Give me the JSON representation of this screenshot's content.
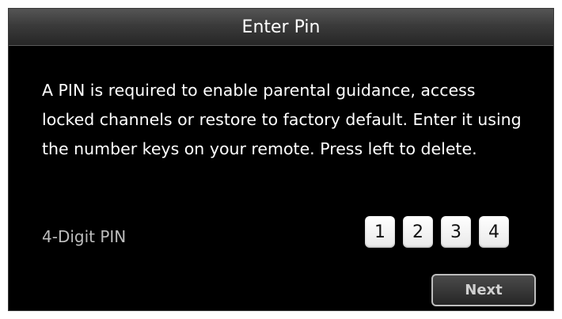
{
  "dialog": {
    "title": "Enter Pin",
    "message": "A PIN is required to enable parental guidance, access locked channels or restore to factory default. Enter it using the number keys on your remote. Press left to delete.",
    "pin_label": "4-Digit PIN",
    "pin_digits": [
      "1",
      "2",
      "3",
      "4"
    ],
    "next_label": "Next"
  },
  "colors": {
    "background": "#000000",
    "title_bar": "#3b3b3b",
    "text": "#ffffff",
    "label_text": "#bdbdbd",
    "pin_box": "#f2f2f2"
  }
}
